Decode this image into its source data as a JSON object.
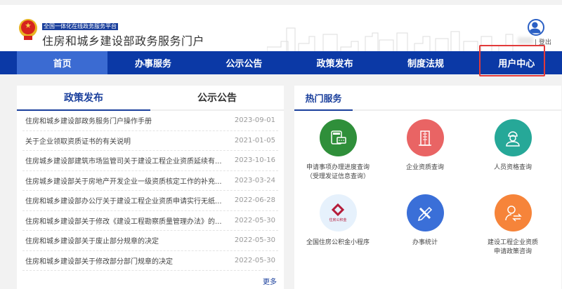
{
  "header": {
    "platform_badge": "全国一体化在线政务服务平台",
    "site_title": "住房和城乡建设部政务服务门户",
    "logout": "| 登出"
  },
  "nav": {
    "items": [
      {
        "label": "首页",
        "active": true
      },
      {
        "label": "办事服务"
      },
      {
        "label": "公示公告"
      },
      {
        "label": "政策发布"
      },
      {
        "label": "制度法规"
      },
      {
        "label": "用户中心",
        "highlighted": true
      }
    ]
  },
  "news": {
    "tabs": [
      {
        "label": "政策发布",
        "active": true
      },
      {
        "label": "公示公告"
      }
    ],
    "items": [
      {
        "title": "住房和城乡建设部政务服务门户操作手册",
        "date": "2023-09-01"
      },
      {
        "title": "关于企业领取资质证书的有关说明",
        "date": "2021-01-05"
      },
      {
        "title": "住房城乡建设部建筑市场监管司关于建设工程企业资质延续有...",
        "date": "2023-10-16"
      },
      {
        "title": "住房城乡建设部关于房地产开发企业一级资质核定工作的补充...",
        "date": "2023-03-24"
      },
      {
        "title": "住房和城乡建设部办公厅关于建设工程企业资质申请实行无纸...",
        "date": "2022-06-28"
      },
      {
        "title": "住房和城乡建设部关于修改《建设工程勘察质量管理办法》的...",
        "date": "2022-05-30"
      },
      {
        "title": "住房和城乡建设部关于废止部分规章的决定",
        "date": "2022-05-30"
      },
      {
        "title": "住房和城乡建设部关于修改部分部门规章的决定",
        "date": "2022-05-30"
      }
    ],
    "more": "更多"
  },
  "services": {
    "title": "热门服务",
    "items": [
      {
        "line1": "申请事项办理进度查询",
        "line2": "（受理发证信息查询）",
        "icon": "calculator-chat-icon",
        "color": "#2f8f3a"
      },
      {
        "line1": "企业资质查询",
        "line2": "",
        "icon": "building-icon",
        "color": "#e96464"
      },
      {
        "line1": "人员资格查询",
        "line2": "",
        "icon": "worker-icon",
        "color": "#26a898"
      },
      {
        "line1": "全国住房公积金小程序",
        "line2": "",
        "icon": "housing-fund-logo-icon",
        "color": "#e6f1fc",
        "logo_text": "住房公积金"
      },
      {
        "line1": "办事统计",
        "line2": "",
        "icon": "pencil-ruler-icon",
        "color": "#3a6fd8"
      },
      {
        "line1": "建设工程企业资质",
        "line2": "申请政策咨询",
        "icon": "user-exchange-icon",
        "color": "#f6843a"
      }
    ]
  }
}
